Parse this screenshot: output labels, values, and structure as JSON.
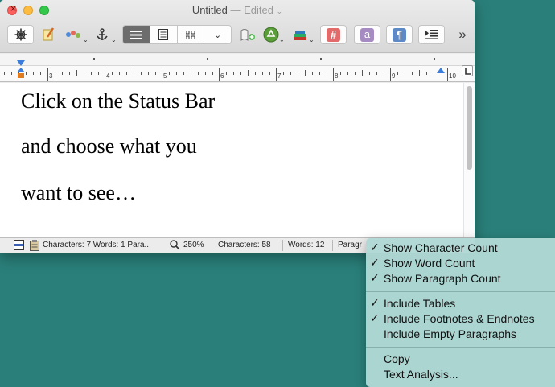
{
  "window": {
    "title": "Untitled",
    "edited": "— Edited",
    "chevron": "⌄"
  },
  "toolbar": {
    "icons": [
      "helm-icon",
      "pencil-note-icon",
      "format-icon",
      "anchor-icon",
      "list-view-icon",
      "page-view-icon",
      "grid-view-icon",
      "more-views-icon",
      "document-add-icon",
      "recycle-icon",
      "books-icon",
      "hash-icon",
      "amazon-icon",
      "pilcrow-icon",
      "indent-icon",
      "overflow-icon"
    ],
    "hash_label": "#",
    "amazon_label": "a",
    "pilcrow_label": "¶",
    "overflow_label": "»"
  },
  "ruler": {
    "numbers": [
      "3",
      "4",
      "5",
      "6",
      "7",
      "8",
      "9",
      "10"
    ],
    "accent_color": "#3b7ddd"
  },
  "document": {
    "lines": [
      "Click on the Status Bar",
      "and choose what you",
      "want to see…"
    ]
  },
  "statusbar": {
    "left_summary": "Characters: 7  Words: 1  Para...",
    "zoom": "250%",
    "characters": "Characters: 58",
    "words": "Words: 12",
    "paragraphs": "Paragr"
  },
  "context_menu": {
    "background": "#afd8d4",
    "items": [
      {
        "label": "Show Character Count",
        "checked": "✓"
      },
      {
        "label": "Show Word Count",
        "checked": "✓"
      },
      {
        "label": "Show Paragraph Count",
        "checked": "✓"
      },
      {
        "label": "Include Tables",
        "checked": "✓"
      },
      {
        "label": "Include Footnotes & Endnotes",
        "checked": "✓"
      },
      {
        "label": "Include Empty Paragraphs",
        "checked": ""
      },
      {
        "label": "Copy",
        "checked": ""
      },
      {
        "label": "Text Analysis...",
        "checked": ""
      }
    ]
  }
}
